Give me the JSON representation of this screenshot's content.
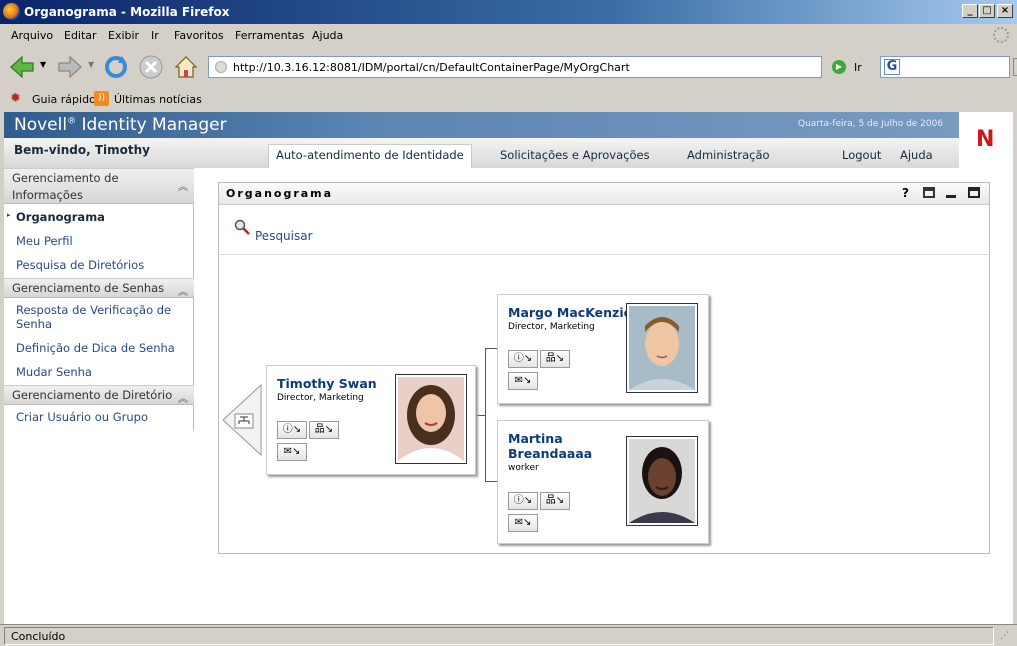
{
  "window": {
    "title": "Organograma - Mozilla Firefox"
  },
  "menu": [
    "Arquivo",
    "Editar",
    "Exibir",
    "Ir",
    "Favoritos",
    "Ferramentas",
    "Ajuda"
  ],
  "address": {
    "url": "http://10.3.16.12:8081/IDM/portal/cn/DefaultContainerPage/MyOrgChart",
    "go_label": "Ir"
  },
  "bookmarks": [
    "Guia rápido",
    "Últimas notícias"
  ],
  "app": {
    "brand": "Novell",
    "brand_mark": "®",
    "product": "Identity Manager",
    "date": "Quarta-feira, 5 de Julho de 2006",
    "welcome": "Bem-vindo, Timothy",
    "logo_letter": "N"
  },
  "tabs": [
    "Auto-atendimento de Identidade",
    "Solicitações e Aprovações",
    "Administração"
  ],
  "header_links": {
    "logout": "Logout",
    "help": "Ajuda"
  },
  "sidebar": {
    "sections": [
      {
        "title": "Gerenciamento de Informações",
        "title_lines": [
          "Gerenciamento de",
          "Informações"
        ],
        "items": [
          "Organograma",
          "Meu Perfil",
          "Pesquisa de Diretórios"
        ]
      },
      {
        "title": "Gerenciamento de Senhas",
        "items": [
          "Resposta de Verificação de Senha",
          "Definição de Dica de Senha",
          "Mudar Senha"
        ],
        "item0_lines": [
          "Resposta de Verificação de",
          "Senha"
        ]
      },
      {
        "title": "Gerenciamento de Diretório",
        "items": [
          "Criar Usuário ou Grupo"
        ]
      }
    ]
  },
  "portlet": {
    "title": "Organograma",
    "search_label": "Pesquisar"
  },
  "orgchart": {
    "root": {
      "name": "Timothy Swan",
      "title": "Director, Marketing"
    },
    "reports": [
      {
        "name": "Margo MacKenzie",
        "title": "Director, Marketing"
      },
      {
        "name": "Martina Breandaaaa",
        "name_lines": [
          "Martina",
          "Breandaaaa"
        ],
        "title": "worker"
      }
    ]
  },
  "status": "Concluído",
  "colors": {
    "accent": "#0c3a7a",
    "brand_red": "#d4141c",
    "header_blue": "#2f5c8c"
  }
}
